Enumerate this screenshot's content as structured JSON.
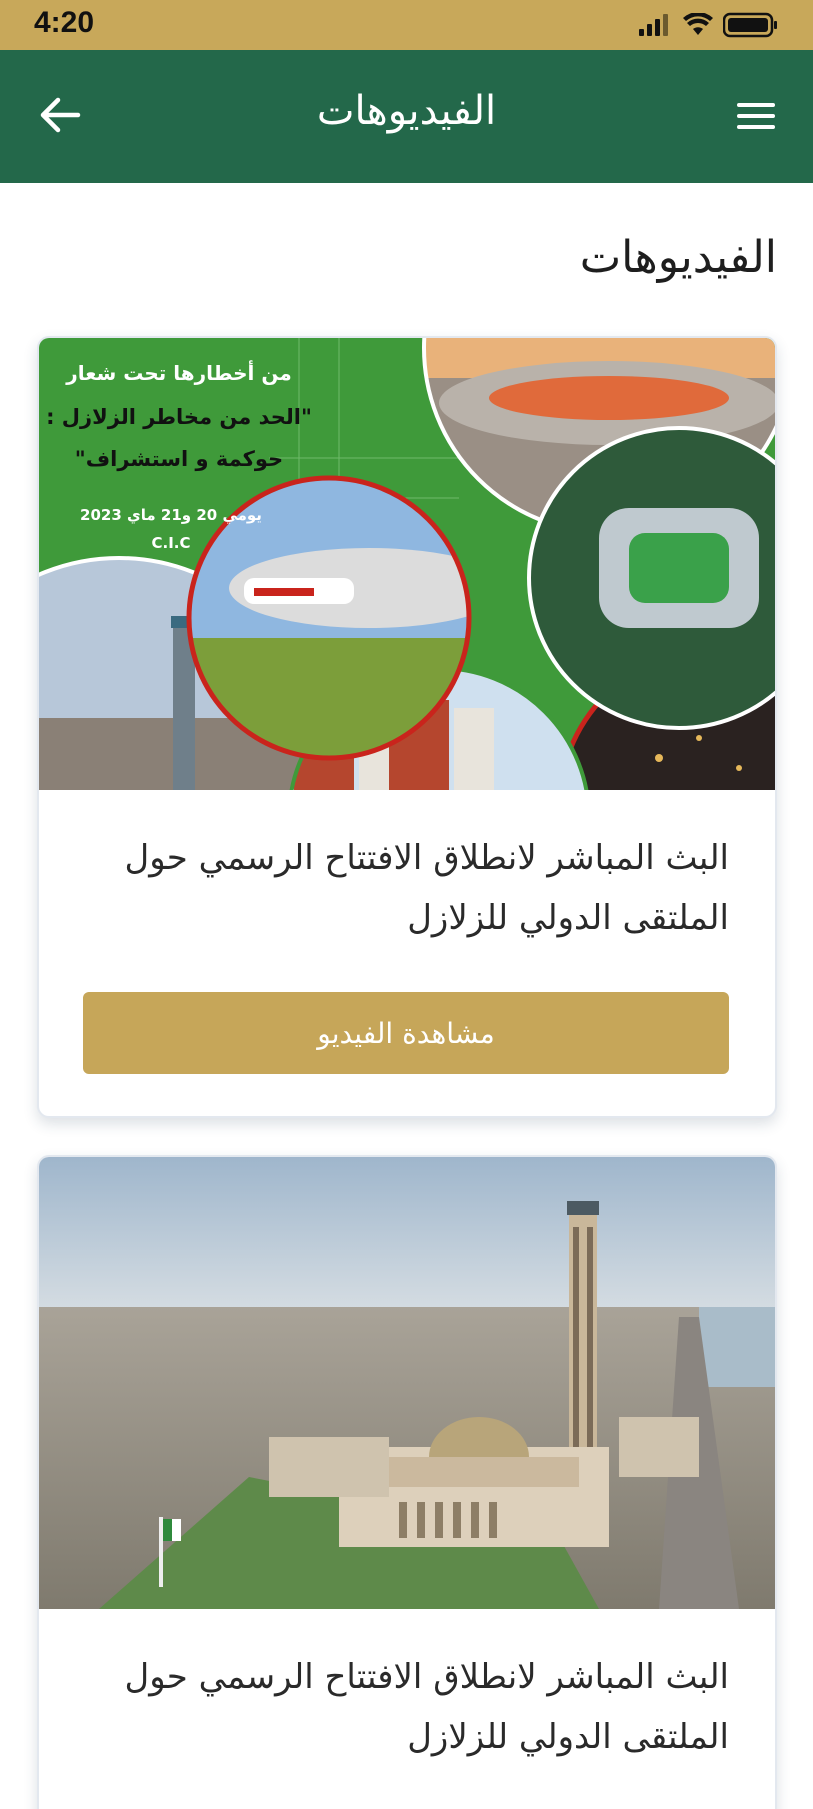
{
  "status_bar": {
    "time": "4:20",
    "icons": [
      "signal-icon",
      "wifi-icon",
      "battery-icon"
    ]
  },
  "app_bar": {
    "title": "الفيديوهات",
    "back_icon": "arrow-left-icon",
    "menu_icon": "hamburger-menu-icon"
  },
  "page": {
    "heading": "الفيديوهات"
  },
  "videos": [
    {
      "poster_text": {
        "line1": "من أخطارها تحت شعار",
        "line2": "\"الحد من مخاطر الزلازل :",
        "line3": "حوكمة و استشراف\"",
        "line4": "يومي 20 و21 ماي 2023",
        "line5": "C.I.C"
      },
      "title": "البث المباشر لانطلاق الافتتاح الرسمي حول الملتقى الدولي للزلازل",
      "button_label": "مشاهدة الفيديو"
    },
    {
      "title": "البث المباشر لانطلاق الافتتاح الرسمي حول الملتقى الدولي للزلازل"
    }
  ],
  "colors": {
    "status_bar": "#c8a85a",
    "app_bar": "#23684a",
    "button": "#c6a659",
    "poster_green": "#3f9a3a",
    "poster_red": "#c9241c"
  }
}
